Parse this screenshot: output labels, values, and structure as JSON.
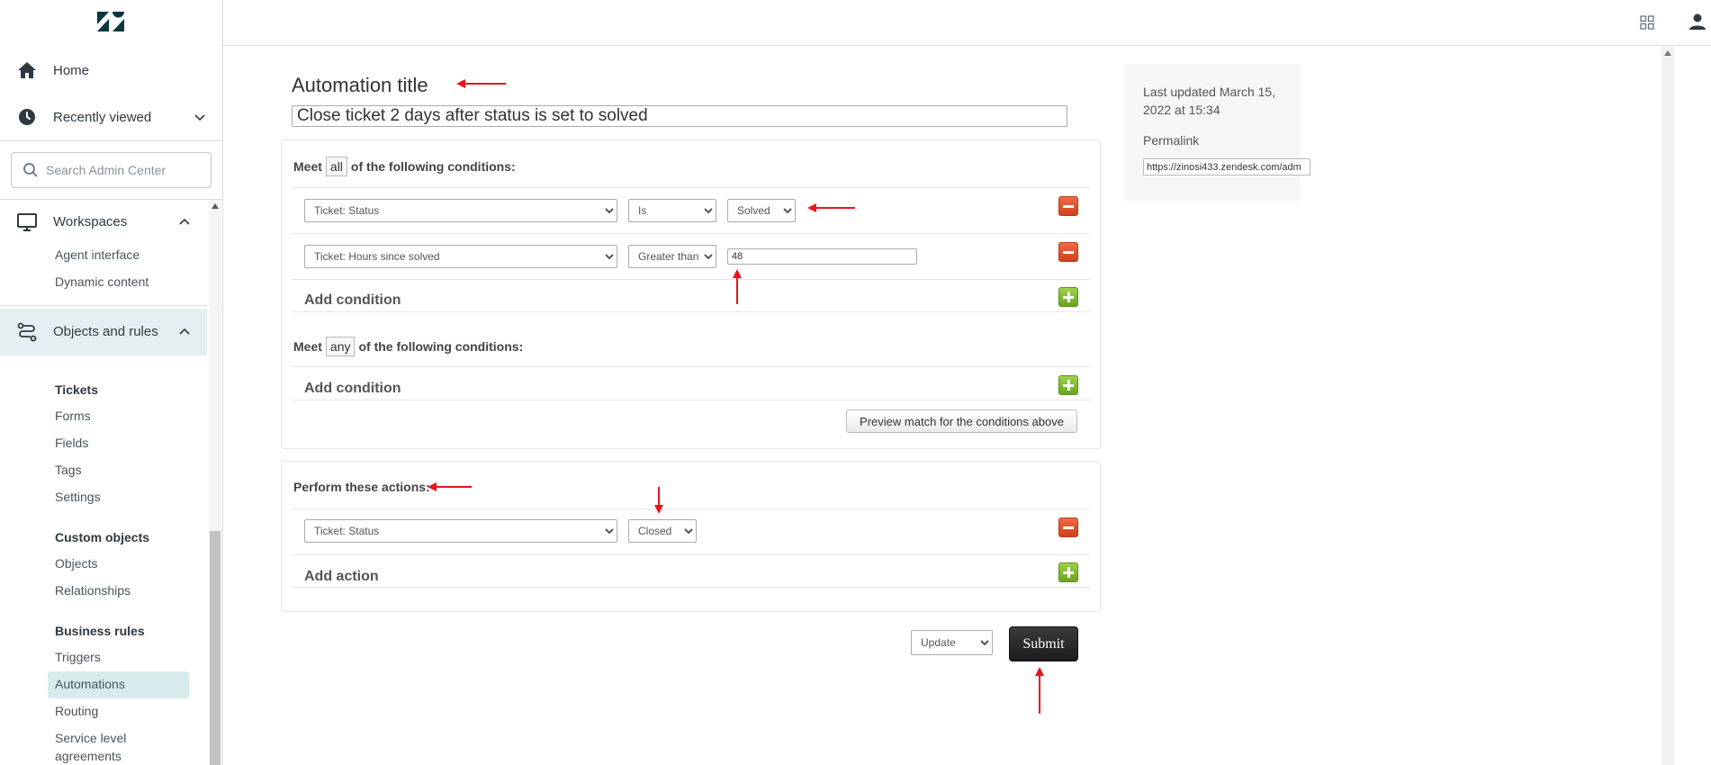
{
  "sidebar": {
    "home_label": "Home",
    "recently_viewed_label": "Recently viewed",
    "search_placeholder": "Search Admin Center",
    "workspaces": {
      "label": "Workspaces",
      "items": [
        "Agent interface",
        "Dynamic content"
      ]
    },
    "objects_and_rules": {
      "label": "Objects and rules",
      "tickets_heading": "Tickets",
      "tickets_items": [
        "Forms",
        "Fields",
        "Tags",
        "Settings"
      ],
      "custom_objects_heading": "Custom objects",
      "custom_objects_items": [
        "Objects",
        "Relationships"
      ],
      "business_rules_heading": "Business rules",
      "business_rules_items": [
        "Triggers",
        "Automations",
        "Routing",
        "Service level",
        "agreements"
      ],
      "active_item": "Automations"
    }
  },
  "form": {
    "title_heading": "Automation title",
    "title_value": "Close ticket 2 days after status is set to solved",
    "all_conditions": {
      "meet_prefix": "Meet",
      "meet_word": "all",
      "meet_suffix": "of the following conditions:",
      "rows": [
        {
          "field": "Ticket: Status",
          "operator": "Is",
          "value": "Solved"
        },
        {
          "field": "Ticket: Hours since solved",
          "operator": "Greater than",
          "value": "48"
        }
      ],
      "add_label": "Add condition"
    },
    "any_conditions": {
      "meet_prefix": "Meet",
      "meet_word": "any",
      "meet_suffix": "of the following conditions:",
      "add_label": "Add condition"
    },
    "preview_button": "Preview match for the conditions above",
    "actions": {
      "heading": "Perform these actions:",
      "rows": [
        {
          "field": "Ticket: Status",
          "value": "Closed"
        }
      ],
      "add_label": "Add action"
    },
    "submit_mode": "Update",
    "submit_label": "Submit"
  },
  "info": {
    "last_updated": "Last updated March 15, 2022 at 15:34",
    "permalink_label": "Permalink",
    "permalink_value": "https://zinosi433.zendesk.com/adm"
  },
  "colors": {
    "annotation_arrow": "#e8141c",
    "active_nav_bg": "#e3eff0",
    "minus_button": "#d9472b",
    "plus_button": "#7fba2e",
    "submit_button": "#2a2a2a"
  }
}
